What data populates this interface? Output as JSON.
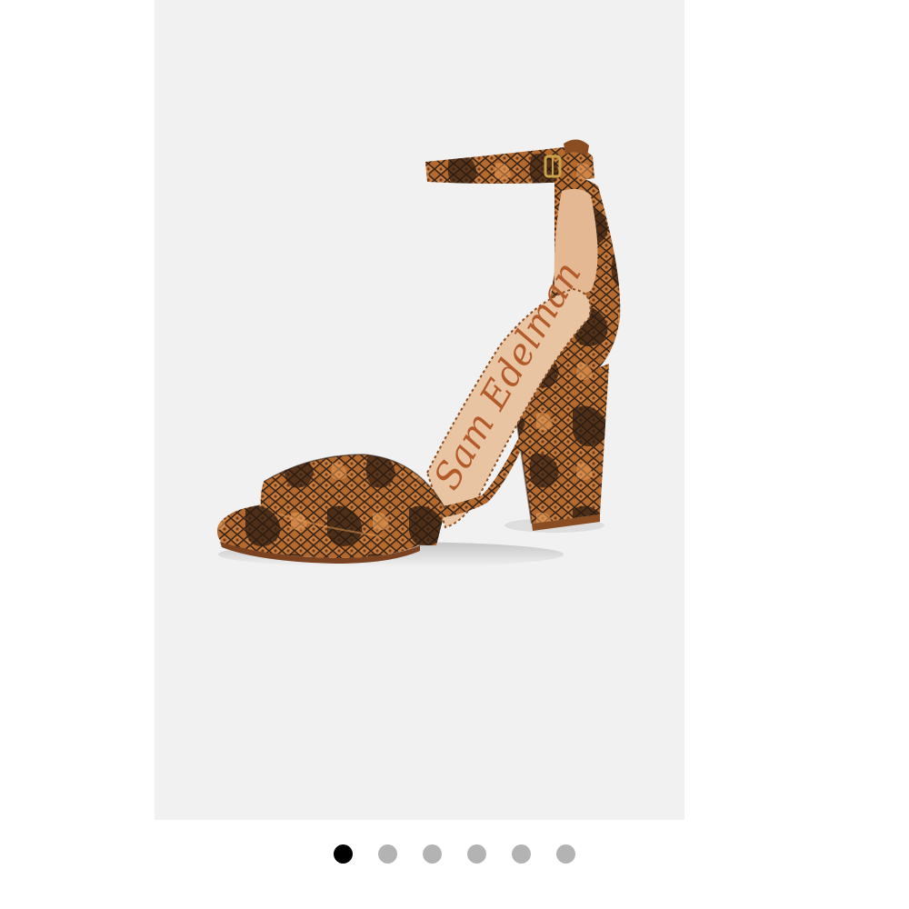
{
  "gallery": {
    "current_index": 1,
    "total_images": 6,
    "brand_signature": "Sam Edelman",
    "dots": [
      {
        "state": "active"
      },
      {
        "state": "inactive"
      },
      {
        "state": "inactive"
      },
      {
        "state": "inactive"
      },
      {
        "state": "inactive"
      },
      {
        "state": "inactive"
      }
    ]
  },
  "colors": {
    "slide_background": "#f1f1f1",
    "dot_active": "#000000",
    "dot_inactive": "#b3b3b3",
    "snakeskin_base": "#b4692f",
    "snakeskin_dark": "#3a2416",
    "insole": "#e9c4a2"
  }
}
